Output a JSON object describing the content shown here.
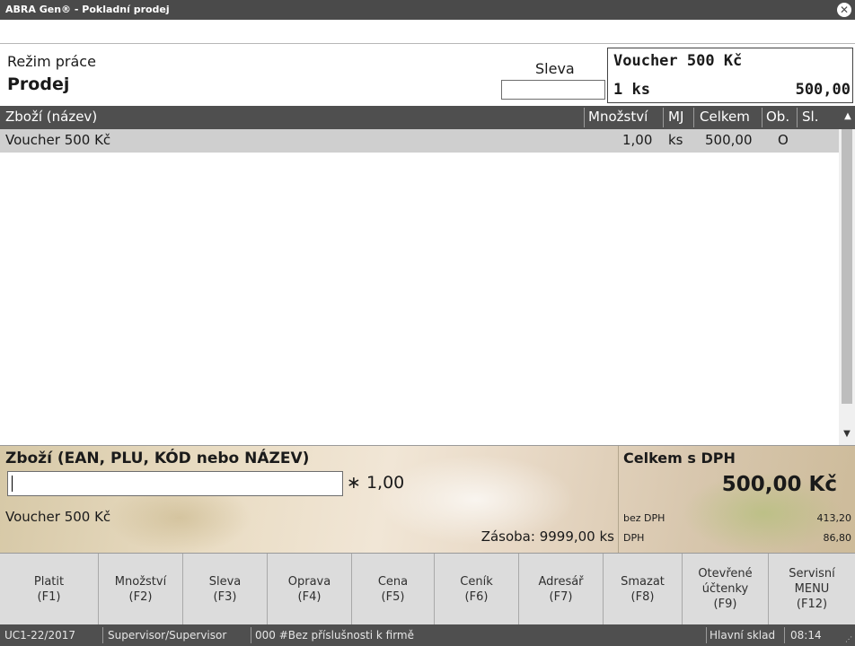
{
  "window": {
    "title": "ABRA Gen® - Pokladní prodej",
    "close_icon": "close-icon"
  },
  "header": {
    "mode_label": "Režim práce",
    "mode_value": "Prodej",
    "sleva_label": "Sleva",
    "sleva_value": "",
    "display": {
      "line1": "Voucher 500 Kč",
      "line2_left": "1 ks",
      "line2_right": "500,00"
    }
  },
  "table": {
    "columns": [
      "Zboží (název)",
      "Množství",
      "MJ",
      "Celkem",
      "Ob.",
      "Sl."
    ],
    "rows": [
      {
        "name": "Voucher 500 Kč",
        "qty": "1,00",
        "unit": "ks",
        "total": "500,00",
        "ob": "O",
        "sl": ""
      }
    ]
  },
  "entry": {
    "label": "Zboží (EAN, PLU, KÓD nebo NÁZEV)",
    "input_value": "",
    "quantity": "∗ 1,00",
    "last_item": "Voucher 500 Kč",
    "stock": "Zásoba: 9999,00 ks"
  },
  "totals": {
    "label": "Celkem s DPH",
    "value": "500,00 Kč",
    "bez_dph_label": "bez DPH",
    "bez_dph_value": "413,20",
    "dph_label": "DPH",
    "dph_value": "86,80"
  },
  "buttons": [
    {
      "label": "Platit\n(F1)"
    },
    {
      "label": "Množství\n(F2)"
    },
    {
      "label": "Sleva\n(F3)"
    },
    {
      "label": "Oprava\n(F4)"
    },
    {
      "label": "Cena\n(F5)"
    },
    {
      "label": "Ceník\n(F6)"
    },
    {
      "label": "Adresář\n(F7)"
    },
    {
      "label": "Smazat\n(F8)"
    },
    {
      "label": "Otevřené\núčtenky\n(F9)"
    },
    {
      "label": "Servisní\nMENU\n(F12)"
    }
  ],
  "status": {
    "doc": "UC1-22/2017",
    "user": "Supervisor/Supervisor",
    "firm": "000 #Bez příslušnosti k firmě",
    "store": "Hlavní sklad",
    "time": "08:14"
  },
  "colors": {
    "titlebar": "#4a4a4a",
    "table_header": "#4f4f4f",
    "selected_row": "#cfcfcf",
    "statusbar": "#4f4f4f"
  }
}
